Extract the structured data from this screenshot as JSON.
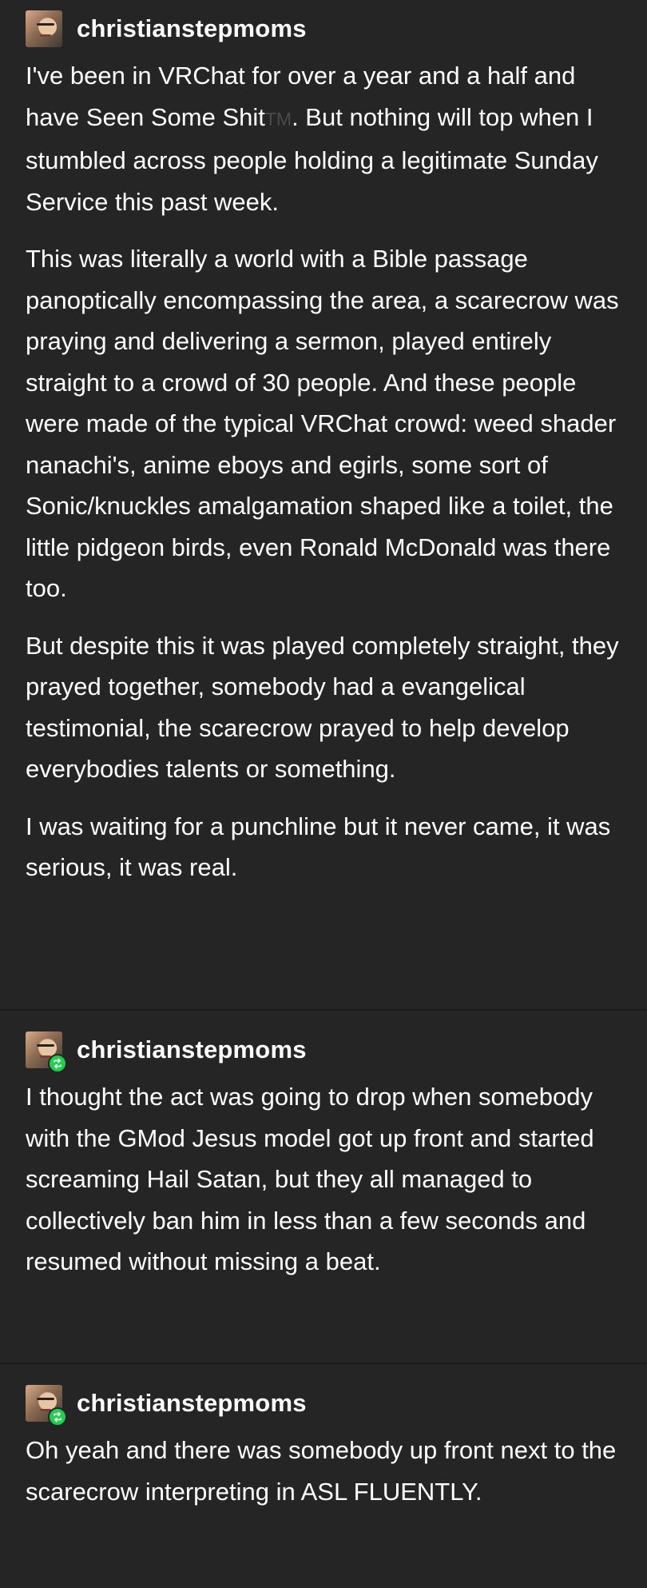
{
  "posts": [
    {
      "username": "christianstepmoms",
      "is_reblog": false,
      "paragraphs": [
        {
          "before": "I've been in VRChat for over a year and a half and have Seen Some Shit",
          "tm": "TM",
          "after": ". But nothing will top when I stumbled across people holding a legitimate Sunday Service this past week."
        },
        {
          "text": "This was literally a world with a Bible passage panoptically encompassing the area, a scarecrow was praying and delivering a sermon, played entirely straight to a crowd of 30 people. And these people were made of the typical VRChat crowd: weed shader nanachi's, anime eboys and egirls, some sort of Sonic/knuckles amalgamation shaped like a toilet, the little pidgeon birds, even Ronald McDonald was there too."
        },
        {
          "text": "But despite this it was played completely straight, they prayed together, somebody had a evangelical testimonial, the scarecrow prayed to help develop everybodies talents or something."
        },
        {
          "text": "I was waiting for a punchline but it never came, it was serious, it was real."
        }
      ]
    },
    {
      "username": "christianstepmoms",
      "is_reblog": true,
      "paragraphs": [
        {
          "text": "I thought the act was going to drop when somebody with the GMod Jesus model got up front and started screaming Hail Satan, but they all managed to collectively ban him in less than a few seconds and resumed without missing a beat."
        }
      ]
    },
    {
      "username": "christianstepmoms",
      "is_reblog": true,
      "paragraphs": [
        {
          "text": "Oh yeah and there was somebody up front next to the scarecrow interpreting in ASL FLUENTLY."
        }
      ]
    }
  ],
  "colors": {
    "background": "#252525",
    "divider": "#1a1a1a",
    "text": "#ffffff",
    "reblog_badge": "#1fcf4e"
  },
  "icons": {
    "avatar": "avatar-icon",
    "reblog": "reblog-icon"
  }
}
